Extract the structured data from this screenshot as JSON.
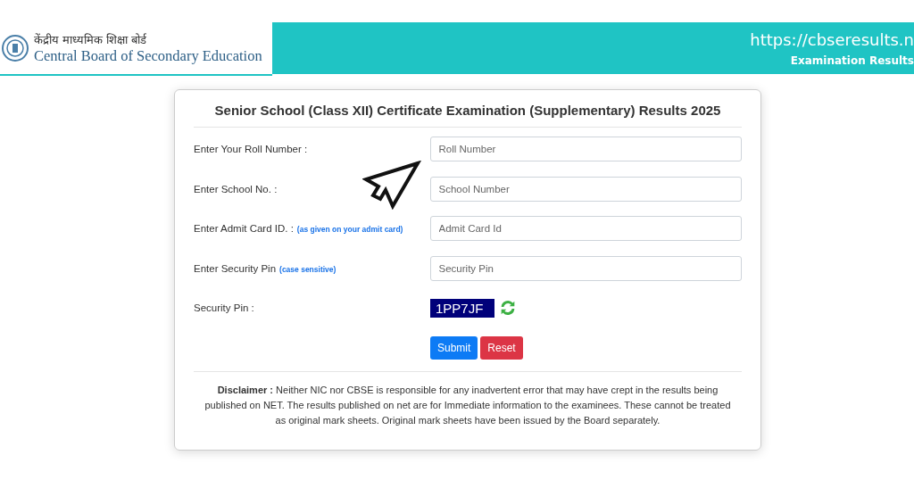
{
  "header": {
    "hindi_name": "केंद्रीय माध्यमिक शिक्षा बोर्ड",
    "english_name": "Central Board of Secondary Education",
    "url": "https://cbseresults.n",
    "subtitle": "Examination Results"
  },
  "form": {
    "title": "Senior School (Class XII) Certificate Examination (Supplementary) Results 2025",
    "fields": [
      {
        "label": "Enter Your Roll Number :",
        "placeholder": "Roll Number"
      },
      {
        "label": "Enter School No. :",
        "placeholder": "School Number"
      },
      {
        "label": "Enter Admit Card ID. :",
        "hint": "(as given on your admit card)",
        "placeholder": "Admit Card Id"
      },
      {
        "label": "Enter Security Pin",
        "hint": "(case sensitive)",
        "placeholder": "Security Pin"
      }
    ],
    "captcha": {
      "label": "Security Pin :",
      "code": "1PP7JF"
    },
    "buttons": [
      {
        "label": "Submit",
        "kind": "primary"
      },
      {
        "label": "Reset",
        "kind": "danger"
      }
    ],
    "disclaimer": "**Disclaimer :** Neither NIC nor CBSE is responsible for any inadvertent error that may have crept in the results being published on NET. The results published on net are for Immediate information to the examinees. These cannot be treated as original mark sheets. Original mark sheets have been issued by the Board separately."
  }
}
